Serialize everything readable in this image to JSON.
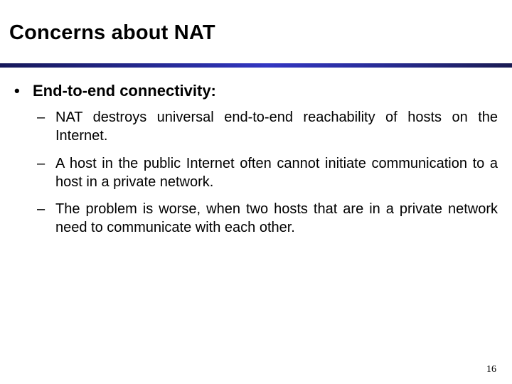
{
  "slide": {
    "title": "Concerns about NAT",
    "bullet": {
      "marker": "•",
      "text": "End-to-end connectivity:"
    },
    "sub_items": [
      {
        "marker": "–",
        "text": "NAT destroys universal end-to-end reachability of hosts on the Internet."
      },
      {
        "marker": "–",
        "text": "A host in the public Internet often cannot initiate communication to a host in a private network."
      },
      {
        "marker": "–",
        "text": "The problem is worse, when two hosts that are in a private network need to communicate with each other."
      }
    ],
    "page_number": "16",
    "colors": {
      "rule_dark": "#16185a",
      "rule_bright": "#3336c2"
    }
  }
}
